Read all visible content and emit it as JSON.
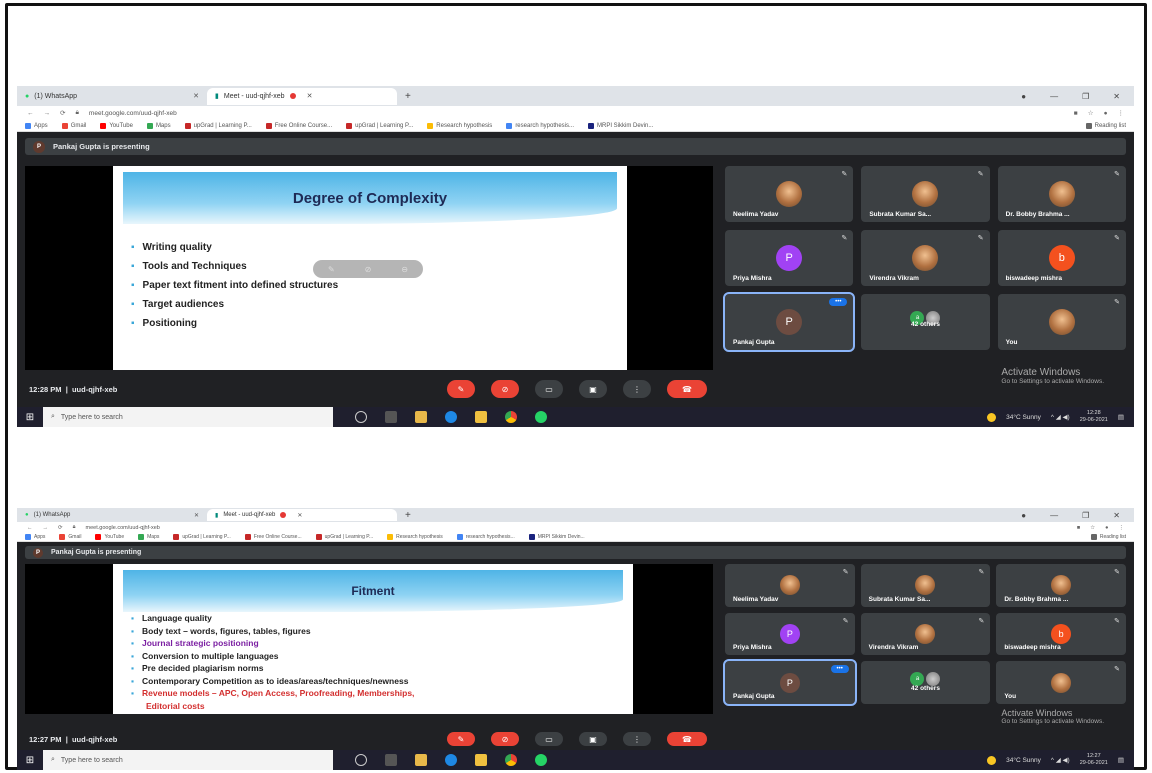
{
  "browser": {
    "tabs": [
      {
        "label": "(1) WhatsApp",
        "active": false
      },
      {
        "label": "Meet - uud-qjhf-xeb",
        "active": true
      }
    ],
    "url": "meet.google.com/uud-qjhf-xeb",
    "bookmarks": [
      "Apps",
      "Gmail",
      "YouTube",
      "Maps",
      "upGrad | Learning P...",
      "Free Online Course...",
      "upGrad | Learning P...",
      "Research hypothesis",
      "research hypothesis...",
      "MRPI Sikkim Devin...",
      "Reading list"
    ]
  },
  "screens": [
    {
      "presenting_text": "Pankaj Gupta is presenting",
      "presenter_initial": "P",
      "slide_title": "Degree of Complexity",
      "bullets": [
        {
          "text": "Writing quality",
          "style": "normal"
        },
        {
          "text": "Tools and Techniques",
          "style": "normal"
        },
        {
          "text": "Paper text fitment into defined structures",
          "style": "normal"
        },
        {
          "text": "Target  audiences",
          "style": "normal"
        },
        {
          "text": "Positioning",
          "style": "normal"
        }
      ],
      "time": "12:28 PM",
      "meeting_code": "uud-qjhf-xeb",
      "clock_time": "12:28",
      "clock_date": "29-06-2021"
    },
    {
      "presenting_text": "Pankaj Gupta is presenting",
      "presenter_initial": "P",
      "slide_title": "Fitment",
      "bullets": [
        {
          "text": "Language quality",
          "style": "normal"
        },
        {
          "text": "Body text – words, figures, tables, figures",
          "style": "normal"
        },
        {
          "text": "Journal strategic positioning",
          "style": "purple"
        },
        {
          "text": "Conversion to multiple languages",
          "style": "normal"
        },
        {
          "text": "Pre decided plagiarism norms",
          "style": "normal"
        },
        {
          "text": "Contemporary Competition as to ideas/areas/techniques/newness",
          "style": "normal"
        },
        {
          "text": "Revenue models – APC, Open Access, Proofreading, Memberships,",
          "style": "red"
        },
        {
          "text": "Editorial costs",
          "style": "red-cont"
        }
      ],
      "time": "12:27 PM",
      "meeting_code": "uud-qjhf-xeb",
      "clock_time": "12:27",
      "clock_date": "29-06-2021"
    }
  ],
  "participants": [
    {
      "name": "Neelima Yadav",
      "type": "photo",
      "initial": ""
    },
    {
      "name": "Subrata Kumar Sa...",
      "type": "photo",
      "initial": ""
    },
    {
      "name": "Dr. Bobby Brahma ...",
      "type": "photo",
      "initial": ""
    },
    {
      "name": "Priya Mishra",
      "type": "purple",
      "initial": "P"
    },
    {
      "name": "Virendra Vikram",
      "type": "photo",
      "initial": ""
    },
    {
      "name": "biswadeep mishra",
      "type": "orange",
      "initial": "b"
    },
    {
      "name": "Pankaj Gupta",
      "type": "brown",
      "initial": "P"
    },
    {
      "name": "42 others",
      "type": "others",
      "initial": "a"
    },
    {
      "name": "You",
      "type": "photo",
      "initial": ""
    }
  ],
  "windows_activation": {
    "title": "Activate Windows",
    "subtitle": "Go to Settings to activate Windows."
  },
  "taskbar": {
    "search_placeholder": "Type here to search",
    "weather": "34°C  Sunny"
  },
  "colors": {
    "meet_bg": "#202124",
    "tile_bg": "#3c4043",
    "end_call": "#ea4335",
    "slide_header": "#4fb4e6"
  }
}
